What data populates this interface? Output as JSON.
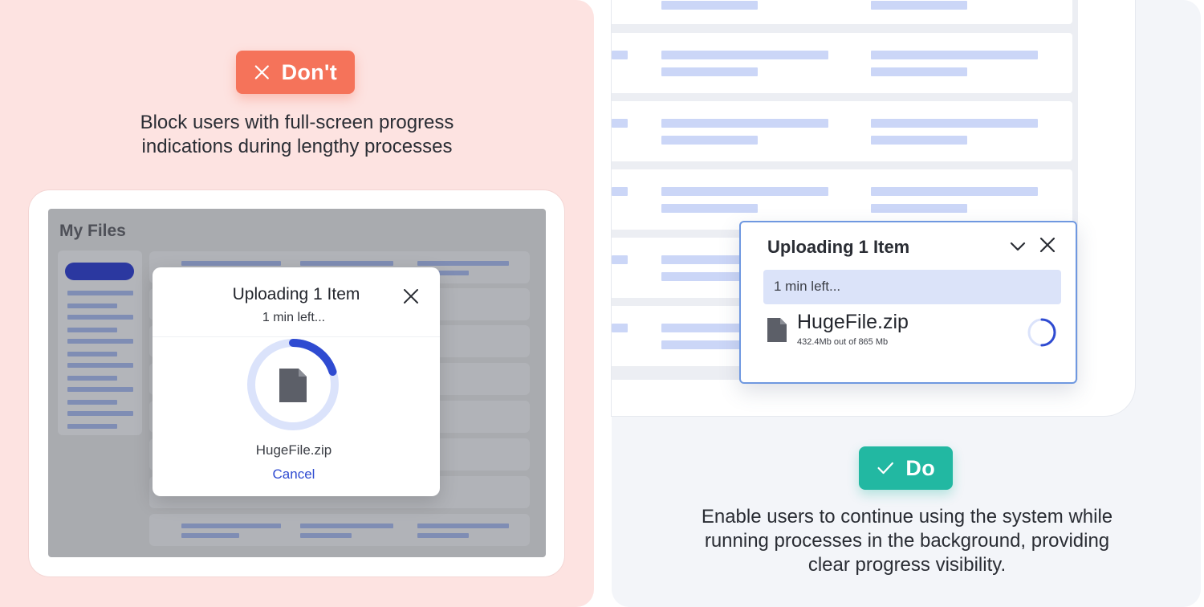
{
  "dont": {
    "badge_label": "Don't",
    "badge_icon": "close-icon",
    "caption_line1": "Block users with full-screen progress",
    "caption_line2": "indications during lengthy processes",
    "screen_title": "My Files",
    "modal": {
      "title": "Uploading 1 Item",
      "subtitle": "1 min left...",
      "file_name": "HugeFile.zip",
      "cancel_label": "Cancel",
      "progress": 0.2
    }
  },
  "do": {
    "badge_label": "Do",
    "badge_icon": "check-icon",
    "caption_line1": "Enable users to continue using the system while",
    "caption_line2": "running processes in the background, providing",
    "caption_line3": "clear progress visibility.",
    "upload_panel": {
      "title": "Uploading 1 Item",
      "status": "1 min left...",
      "file_name": "HugeFile.zip",
      "file_size": "432.4Mb out of 865 Mb",
      "progress": 0.5
    }
  },
  "colors": {
    "dont_bg": "#fde3e1",
    "dont_accent": "#f5735a",
    "do_bg": "#f3f5f9",
    "do_accent": "#22b8a2",
    "progress_blue": "#2f4bd1",
    "skeleton_blue": "#cbd6f7"
  }
}
